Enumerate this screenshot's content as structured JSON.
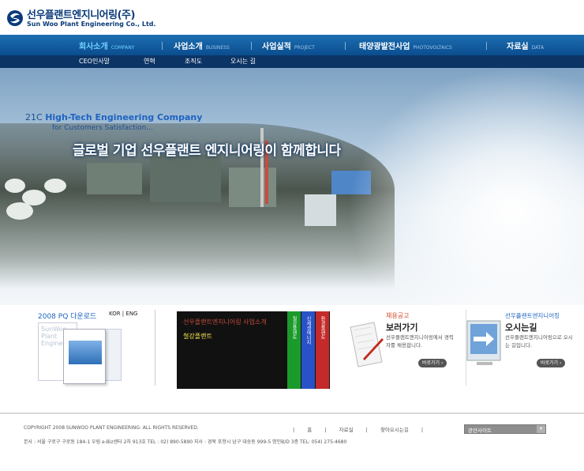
{
  "logo": {
    "name_ko": "선우플랜트엔지니어링(주)",
    "name_en": "Sun Woo Plant Engineering Co., Ltd."
  },
  "nav": {
    "items": [
      {
        "label": "회사소개",
        "sub": "COMPANY",
        "active": true
      },
      {
        "label": "사업소개",
        "sub": "BUSINESS",
        "active": false
      },
      {
        "label": "사업실적",
        "sub": "PROJECT",
        "active": false
      },
      {
        "label": "태양광발전사업",
        "sub": "PHOTOVOLTAICS",
        "active": false
      },
      {
        "label": "자료실",
        "sub": "DATA",
        "active": false
      }
    ]
  },
  "subnav": {
    "items": [
      "CEO인사말",
      "연혁",
      "조직도",
      "오시는 길"
    ]
  },
  "hero": {
    "tag_prefix": "21C",
    "tag_highlight": "High-Tech Engineering Company",
    "tag_for": "for Customers Satisfaction...",
    "headline": "글로벌 기업 선우플랜트 엔지니어링이 함께합니다"
  },
  "pq": {
    "title": "2008 PQ 다운로드",
    "lang": "KOR | ENG",
    "cover_text": "SunWoo Plant Engineering"
  },
  "board": {
    "hand_title": "선우플랜트엔지니어링 사업소개",
    "steel": "철강플랜트",
    "tabs": [
      {
        "label": "철강플랜트",
        "color": "#1a9a2a"
      },
      {
        "label": "신재생에너지",
        "color": "#2a52c8"
      },
      {
        "label": "환경플랜트",
        "color": "#c42a2a"
      }
    ]
  },
  "recruit": {
    "sub": "채용공고",
    "title": "보러가기",
    "desc": "선우플랜트엔지니어링에서 경력자를 채용합니다.",
    "button": "바로가기 ›"
  },
  "directions": {
    "sub": "선우플랜트엔지니어링",
    "title": "오시는길",
    "desc": "선우플랜트엔지니어링으로 오시는 길입니다.",
    "button": "바로가기 ›"
  },
  "footer": {
    "copyright": "COPYRIGHT 2008 SUNWOO PLANT ENGINEERING. ALL RIGHTS RESERVED.",
    "links": [
      "|",
      "홈",
      "|",
      "자료실",
      "|",
      "찾아오시는길",
      "|"
    ],
    "address": "본사 : 서울 구로구 구로동 184-1 우림 e-Biz센터 2차 913호   TEL : 02) 890-5890    지사 :  경북 포항시 남구 대송동 999-5 명인B/D 3층    TEL: 054) 275-4680",
    "related_label": "관련사이트",
    "related_arrow": "▾"
  }
}
